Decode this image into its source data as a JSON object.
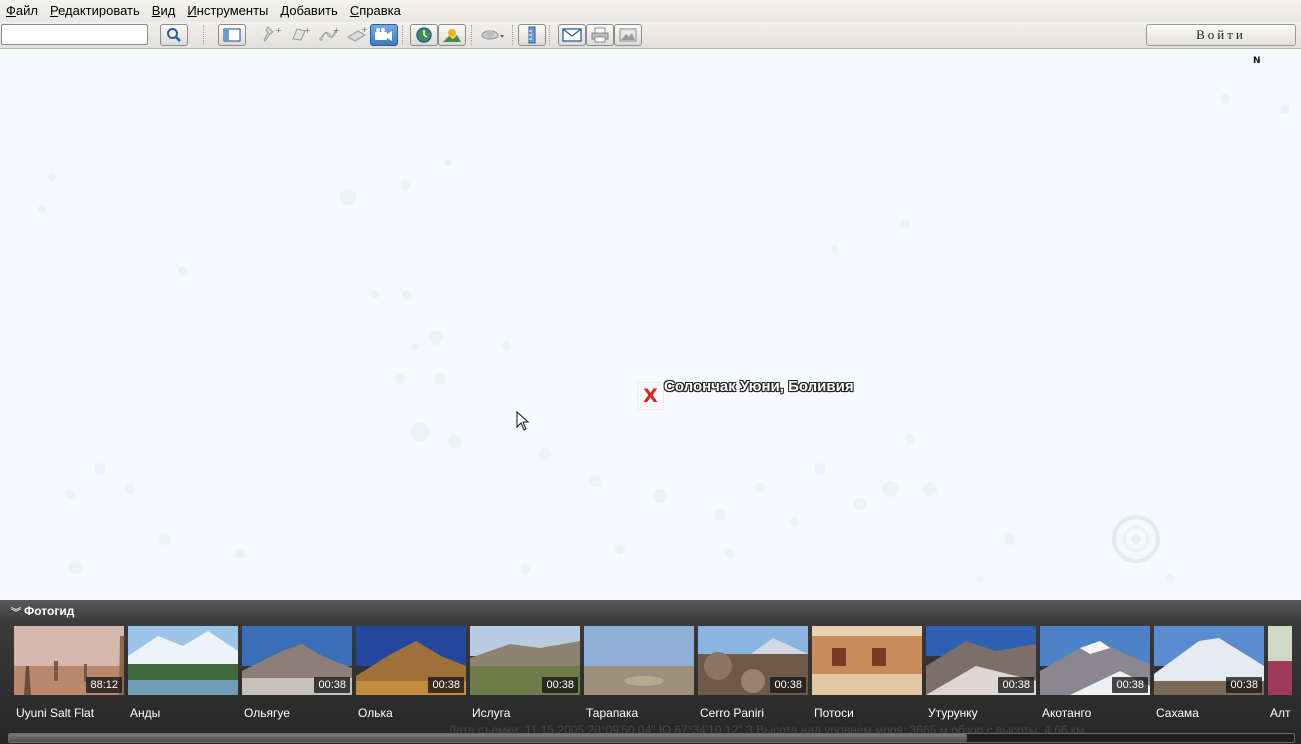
{
  "menu": [
    {
      "label": "Файл",
      "mn": "Ф",
      "rest": "айл"
    },
    {
      "label": "Редактировать",
      "mn": "Р",
      "rest": "едактировать"
    },
    {
      "label": "Вид",
      "mn": "В",
      "rest": "ид"
    },
    {
      "label": "Инструменты",
      "mn": "И",
      "rest": "нструменты"
    },
    {
      "label": "Добавить",
      "mn": "Д",
      "rest": "обавить"
    },
    {
      "label": "Справка",
      "mn": "С",
      "rest": "правка"
    }
  ],
  "toolbar": {
    "search_value": "",
    "signin_label": "Войти"
  },
  "map": {
    "compass": "N",
    "placemark_label": "Солончак Уюни, Боливия",
    "placemark_mark": "X"
  },
  "photoguide": {
    "title": "Фотогид",
    "items": [
      {
        "caption": "Uyuni Salt Flat",
        "duration": "88:12"
      },
      {
        "caption": "Анды",
        "duration": ""
      },
      {
        "caption": "Ольягуе",
        "duration": "00:38"
      },
      {
        "caption": "Олька",
        "duration": "00:38"
      },
      {
        "caption": "Ислуга",
        "duration": "00:38"
      },
      {
        "caption": "Тарапака",
        "duration": ""
      },
      {
        "caption": "Cerro Paniri",
        "duration": "00:38"
      },
      {
        "caption": "Потоси",
        "duration": ""
      },
      {
        "caption": "Утурунку",
        "duration": "00:38"
      },
      {
        "caption": "Акотанго",
        "duration": "00:38"
      },
      {
        "caption": "Сахама",
        "duration": "00:38"
      },
      {
        "caption": "Алт",
        "duration": ""
      }
    ]
  },
  "status_line": "Дата съемки: 11.15.2005     20°09'50.04\" Ю    67°34'10.12\" З  Высота над уровнем моря: 3665 м     обзор с высоты:  4.66 км",
  "colors": {
    "accent": "#3d79c5",
    "placemark": "#e2211c",
    "panel": "#2e2e2e"
  }
}
